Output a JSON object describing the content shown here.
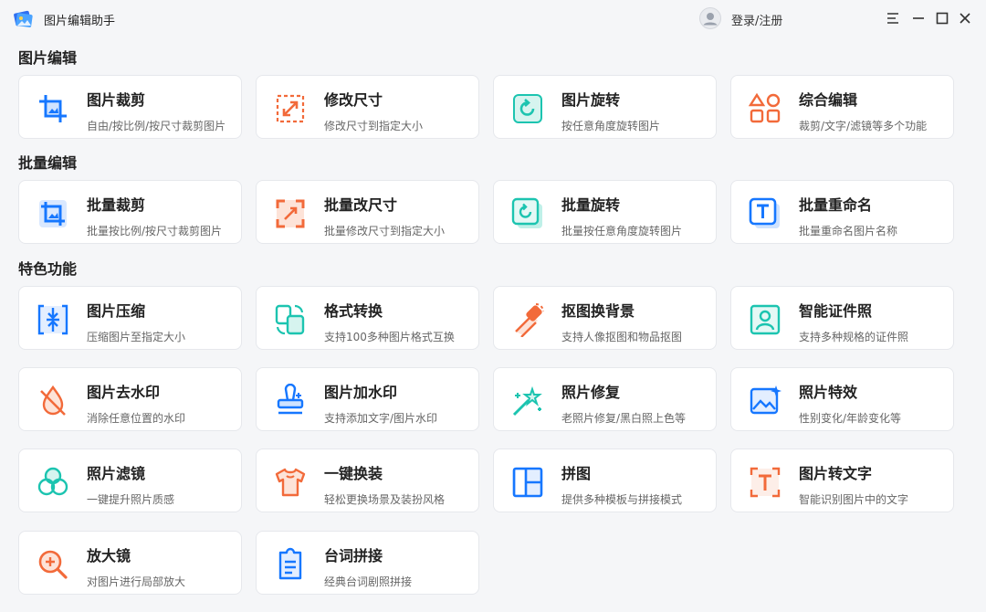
{
  "window": {
    "title": "图片编辑助手",
    "login_label": "登录/注册"
  },
  "sections": [
    {
      "title": "图片编辑"
    },
    {
      "title": "批量编辑"
    },
    {
      "title": "特色功能"
    }
  ],
  "cards": [
    {
      "name": "图片裁剪",
      "desc": "自由/按比例/按尺寸裁剪图片",
      "icon": "crop-icon"
    },
    {
      "name": "修改尺寸",
      "desc": "修改尺寸到指定大小",
      "icon": "resize-icon"
    },
    {
      "name": "图片旋转",
      "desc": "按任意角度旋转图片",
      "icon": "rotate-icon"
    },
    {
      "name": "综合编辑",
      "desc": "裁剪/文字/滤镜等多个功能",
      "icon": "shapes-icon"
    },
    {
      "name": "批量裁剪",
      "desc": "批量按比例/按尺寸裁剪图片",
      "icon": "batch-crop-icon"
    },
    {
      "name": "批量改尺寸",
      "desc": "批量修改尺寸到指定大小",
      "icon": "batch-resize-icon"
    },
    {
      "name": "批量旋转",
      "desc": "批量按任意角度旋转图片",
      "icon": "batch-rotate-icon"
    },
    {
      "name": "批量重命名",
      "desc": "批量重命名图片名称",
      "icon": "rename-icon"
    },
    {
      "name": "图片压缩",
      "desc": "压缩图片至指定大小",
      "icon": "compress-icon"
    },
    {
      "name": "格式转换",
      "desc": "支持100多种图片格式互换",
      "icon": "format-convert-icon"
    },
    {
      "name": "抠图换背景",
      "desc": "支持人像抠图和物品抠图",
      "icon": "eraser-icon"
    },
    {
      "name": "智能证件照",
      "desc": "支持多种规格的证件照",
      "icon": "id-photo-icon"
    },
    {
      "name": "图片去水印",
      "desc": "消除任意位置的水印",
      "icon": "remove-watermark-icon"
    },
    {
      "name": "图片加水印",
      "desc": "支持添加文字/图片水印",
      "icon": "stamp-icon"
    },
    {
      "name": "照片修复",
      "desc": "老照片修复/黑白照上色等",
      "icon": "magic-wand-icon"
    },
    {
      "name": "照片特效",
      "desc": "性别变化/年龄变化等",
      "icon": "image-sparkle-icon"
    },
    {
      "name": "照片滤镜",
      "desc": "一键提升照片质感",
      "icon": "filter-icon"
    },
    {
      "name": "一键换装",
      "desc": "轻松更换场景及装扮风格",
      "icon": "shirt-icon"
    },
    {
      "name": "拼图",
      "desc": "提供多种模板与拼接模式",
      "icon": "collage-icon"
    },
    {
      "name": "图片转文字",
      "desc": "智能识别图片中的文字",
      "icon": "ocr-icon"
    },
    {
      "name": "放大镜",
      "desc": "对图片进行局部放大",
      "icon": "magnifier-icon"
    },
    {
      "name": "台词拼接",
      "desc": "经典台词剧照拼接",
      "icon": "subtitle-icon"
    }
  ],
  "colors": {
    "blue": "#1677ff",
    "orange": "#f26a3a",
    "teal": "#1cc4b0"
  }
}
